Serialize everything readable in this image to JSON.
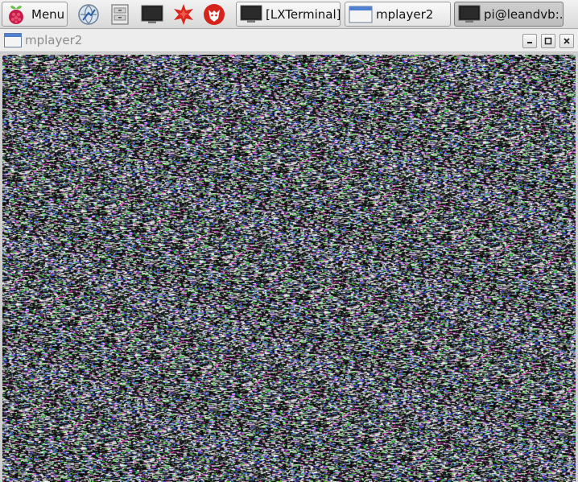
{
  "taskbar": {
    "menu_label": "Menu",
    "launchers": [
      {
        "icon": "web-browser-icon"
      },
      {
        "icon": "file-manager-icon"
      },
      {
        "icon": "terminal-icon"
      },
      {
        "icon": "mathematica-icon"
      },
      {
        "icon": "wolfram-icon"
      }
    ],
    "tasks": [
      {
        "label": "[LXTerminal]",
        "icon": "terminal-icon",
        "active": false
      },
      {
        "label": "mplayer2",
        "icon": "window-icon",
        "active": false
      },
      {
        "label": "pi@leandvb:...",
        "icon": "terminal-icon",
        "active": true
      }
    ]
  },
  "window": {
    "title": "mplayer2",
    "controls": [
      "minimize",
      "maximize",
      "close"
    ],
    "content": "video static noise"
  },
  "colors": {
    "taskbar_bg": "#e6e6e6",
    "title_text": "#8c8c8c",
    "raspberry_red": "#c51a4a",
    "leaf_green": "#6cc04a"
  }
}
